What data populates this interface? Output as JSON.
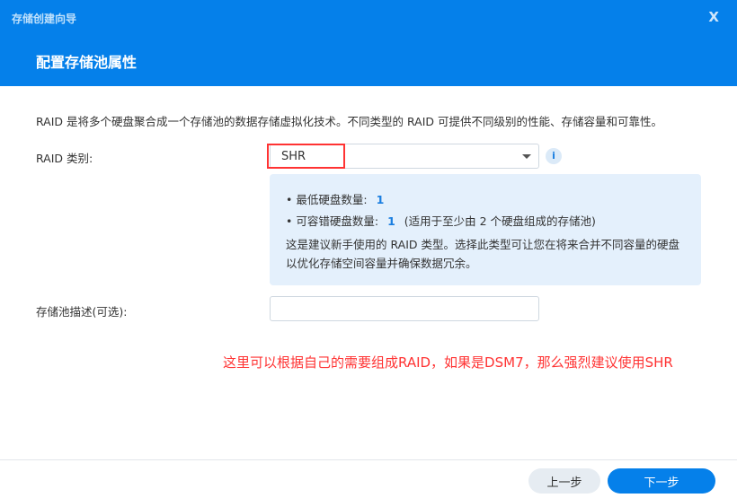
{
  "window": {
    "title": "存储创建向导",
    "close": "X",
    "step_title": "配置存储池属性"
  },
  "description": "RAID 是将多个硬盘聚合成一个存储池的数据存储虚拟化技术。不同类型的 RAID 可提供不同级别的性能、存储容量和可靠性。",
  "raid": {
    "label": "RAID 类别:",
    "value": "SHR",
    "info_icon": "i"
  },
  "info_box": {
    "min_disks_label": "最低硬盘数量:",
    "min_disks": "1",
    "fault_label": "可容错硬盘数量:",
    "fault": "1",
    "fault_note": "(适用于至少由 2 个硬盘组成的存储池)",
    "text": "这是建议新手使用的 RAID 类型。选择此类型可让您在将来合并不同容量的硬盘以优化存储空间容量并确保数据冗余。"
  },
  "pool_desc": {
    "label": "存储池描述(可选):",
    "value": ""
  },
  "annotation": "这里可以根据自己的需要组成RAID，如果是DSM7，那么强烈建议使用SHR",
  "footer": {
    "prev": "上一步",
    "next": "下一步"
  },
  "colors": {
    "accent": "#0580ea",
    "highlight": "#ff3333"
  }
}
